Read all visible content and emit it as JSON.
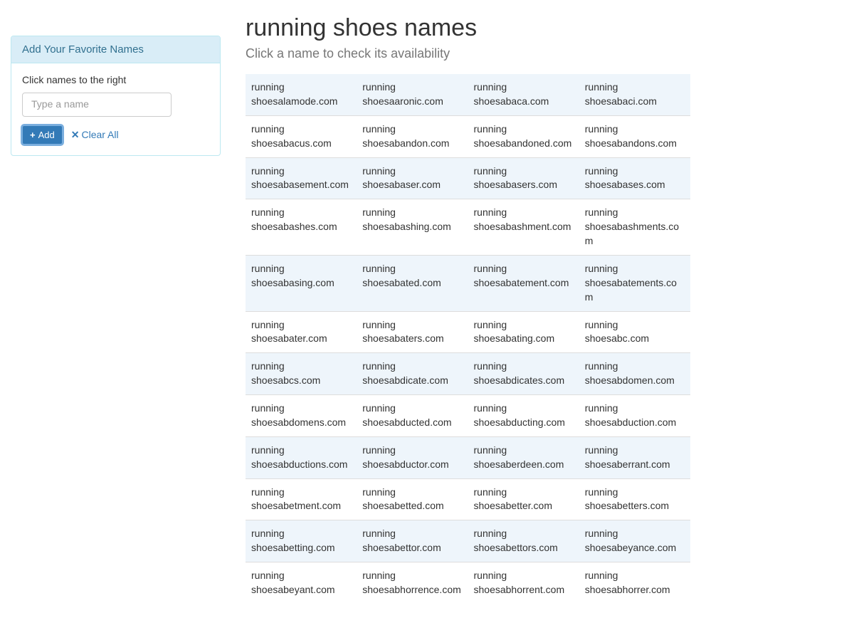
{
  "sidebar": {
    "heading": "Add Your Favorite Names",
    "hint": "Click names to the right",
    "input_placeholder": "Type a name",
    "add_label": "Add",
    "clear_label": "Clear All"
  },
  "main": {
    "title": "running shoes names",
    "subtitle": "Click a name to check its availability"
  },
  "names": [
    [
      "running shoesalamode.com",
      "running shoesaaronic.com",
      "running shoesabaca.com",
      "running shoesabaci.com"
    ],
    [
      "running shoesabacus.com",
      "running shoesabandon.com",
      "running shoesabandoned.com",
      "running shoesabandons.com"
    ],
    [
      "running shoesabasement.com",
      "running shoesabaser.com",
      "running shoesabasers.com",
      "running shoesabases.com"
    ],
    [
      "running shoesabashes.com",
      "running shoesabashing.com",
      "running shoesabashment.com",
      "running shoesabashments.com"
    ],
    [
      "running shoesabasing.com",
      "running shoesabated.com",
      "running shoesabatement.com",
      "running shoesabatements.com"
    ],
    [
      "running shoesabater.com",
      "running shoesabaters.com",
      "running shoesabating.com",
      "running shoesabc.com"
    ],
    [
      "running shoesabcs.com",
      "running shoesabdicate.com",
      "running shoesabdicates.com",
      "running shoesabdomen.com"
    ],
    [
      "running shoesabdomens.com",
      "running shoesabducted.com",
      "running shoesabducting.com",
      "running shoesabduction.com"
    ],
    [
      "running shoesabductions.com",
      "running shoesabductor.com",
      "running shoesaberdeen.com",
      "running shoesaberrant.com"
    ],
    [
      "running shoesabetment.com",
      "running shoesabetted.com",
      "running shoesabetter.com",
      "running shoesabetters.com"
    ],
    [
      "running shoesabetting.com",
      "running shoesabettor.com",
      "running shoesabettors.com",
      "running shoesabeyance.com"
    ],
    [
      "running shoesabeyant.com",
      "running shoesabhorrence.com",
      "running shoesabhorrent.com",
      "running shoesabhorrer.com"
    ]
  ]
}
